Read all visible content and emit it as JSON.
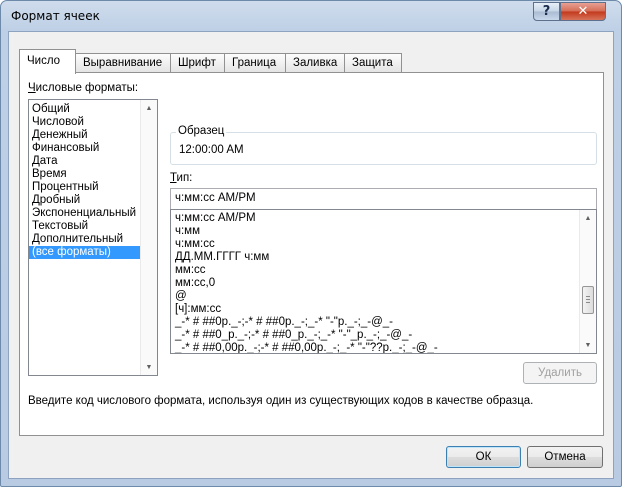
{
  "window": {
    "title": "Формат ячеек",
    "help_label": "?",
    "close_label": "✕"
  },
  "tabs": [
    {
      "label": "Число",
      "active": true
    },
    {
      "label": "Выравнивание",
      "active": false
    },
    {
      "label": "Шрифт",
      "active": false
    },
    {
      "label": "Граница",
      "active": false
    },
    {
      "label": "Заливка",
      "active": false
    },
    {
      "label": "Защита",
      "active": false
    }
  ],
  "categories_label": {
    "accel": "Ч",
    "rest": "исловые форматы:"
  },
  "categories": [
    "Общий",
    "Числовой",
    "Денежный",
    "Финансовый",
    "Дата",
    "Время",
    "Процентный",
    "Дробный",
    "Экспоненциальный",
    "Текстовый",
    "Дополнительный",
    "(все форматы)"
  ],
  "selected_category": "(все форматы)",
  "sample": {
    "label": "Образец",
    "value": "12:00:00 AM"
  },
  "type": {
    "label_accel": "Т",
    "label_rest": "ип:",
    "value": "ч:мм:сс AM/PM"
  },
  "format_codes": [
    "ч:мм:сс AM/PM",
    "ч:мм",
    "ч:мм:сс",
    "ДД.ММ.ГГГГ ч:мм",
    "мм:сс",
    "мм:сс,0",
    "@",
    "[ч]:мм:сс",
    "_-* # ##0р._-;-* # ##0р._-;_-* \"-\"р._-;_-@_-",
    "_-* # ##0_р._-;-* # ##0_р._-;_-* \"-\"_р._-;_-@_-",
    "_-* # ##0,00р._-;-* # ##0,00р._-;_-* \"-\"??р._-;_-@_-"
  ],
  "delete_button": "Удалить",
  "description": "Введите код числового формата, используя один из существующих кодов в качестве образца.",
  "ok_button": "ОК",
  "cancel_button": "Отмена"
}
